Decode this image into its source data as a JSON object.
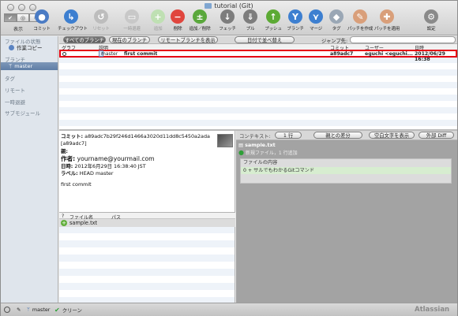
{
  "window": {
    "title": "tutorial (Git)"
  },
  "toolbar": {
    "view_label": "表示",
    "tools": [
      {
        "label": "コミット",
        "icon": "commit-icon",
        "color": "#4a7bc4",
        "glyph": "●",
        "enabled": true
      },
      {
        "label": "チェックアウト",
        "icon": "checkout-icon",
        "color": "#3d7fd0",
        "glyph": "↳",
        "enabled": true
      },
      {
        "label": "リセット",
        "icon": "reset-icon",
        "color": "#bdbdbd",
        "glyph": "↺",
        "enabled": false
      },
      {
        "label": "一時退避",
        "icon": "stash-icon",
        "color": "#c8c8c8",
        "glyph": "▭",
        "enabled": false
      },
      {
        "label": "追加",
        "icon": "add-icon",
        "color": "#bfe0b3",
        "glyph": "+",
        "enabled": false
      },
      {
        "label": "削除",
        "icon": "remove-icon",
        "color": "#e0463e",
        "glyph": "−",
        "enabled": true
      },
      {
        "label": "追加／削除",
        "icon": "add-remove-icon",
        "color": "#5aa83c",
        "glyph": "±",
        "enabled": true
      },
      {
        "label": "フェッチ",
        "icon": "fetch-icon",
        "color": "#7d7d7d",
        "glyph": "↓",
        "enabled": true
      },
      {
        "label": "プル",
        "icon": "pull-icon",
        "color": "#7d7d7d",
        "glyph": "⇓",
        "enabled": true
      },
      {
        "label": "プッシュ",
        "icon": "push-icon",
        "color": "#5caa34",
        "glyph": "↑",
        "enabled": true
      },
      {
        "label": "ブランチ",
        "icon": "branch-icon",
        "color": "#3d7fd0",
        "glyph": "Y",
        "enabled": true
      },
      {
        "label": "マージ",
        "icon": "merge-icon",
        "color": "#3d7fd0",
        "glyph": "⋎",
        "enabled": true
      },
      {
        "label": "タグ",
        "icon": "tag-icon",
        "color": "#9aa7b5",
        "glyph": "◆",
        "enabled": true
      },
      {
        "label": "パッチを作成",
        "icon": "create-patch-icon",
        "color": "#d99f7a",
        "glyph": "✎",
        "enabled": true
      },
      {
        "label": "パッチを適用",
        "icon": "apply-patch-icon",
        "color": "#d99f7a",
        "glyph": "✚",
        "enabled": true
      },
      {
        "label": "設定",
        "icon": "settings-icon",
        "color": "#8a8a8a",
        "glyph": "⚙",
        "enabled": true
      }
    ]
  },
  "sidebar": {
    "file_status_header": "ファイルの状態",
    "working_copy": "作業コピー",
    "branches_header": "ブランチ",
    "current_branch": "master",
    "tags_header": "タグ",
    "remotes_header": "リモート",
    "stashes_header": "一時退避",
    "submodules_header": "サブモジュール"
  },
  "log": {
    "filter_all": "すべてのブランチ",
    "filter_current": "現在のブランチ",
    "filter_remote": "リモートブランチを表示",
    "sort": "日付で並べ替え",
    "jump_label": "ジャンプ先:",
    "jump_value": "",
    "columns": [
      "グラフ",
      "説明",
      "コミット",
      "ユーザー",
      "日時"
    ],
    "rows": [
      {
        "branch": "master",
        "message": "first commit",
        "commit": "a89adc7",
        "user": "eguchi <eguchi...",
        "date": "2012/06/29 16:38"
      }
    ]
  },
  "details": {
    "commit_label": "コミット:",
    "commit_hash": "a89adc7b29f246d1466a3020d11dd8c5450a2ada",
    "short_hash": "[a89adc7]",
    "parent_label": "親:",
    "author_label": "作者:",
    "author": "yourname@yourmail.com",
    "date_label": "日時:",
    "date": "2012年6月29日 16:38:40 JST",
    "labels_label": "ラベル:",
    "labels": "HEAD master",
    "message": "first commit"
  },
  "files": {
    "columns": [
      "?",
      "ファイル名",
      "パス"
    ],
    "items": [
      {
        "name": "sample.txt",
        "path": ""
      }
    ]
  },
  "diff": {
    "context_label": "コンテキスト:",
    "context_value": "1 行",
    "diff_mode": "親との差分",
    "whitespace": "空白文字を表示",
    "external_button": "外部 Diff",
    "file_name": "sample.txt",
    "file_info": "新規ファイル，1 行追加",
    "hunk_header": "ファイルの内容",
    "added_line_no": "0",
    "added_line": "+ サルでもわかるGitコマンド"
  },
  "statusbar": {
    "branch": "master",
    "status": "クリーン",
    "brand": "Atlassian"
  }
}
